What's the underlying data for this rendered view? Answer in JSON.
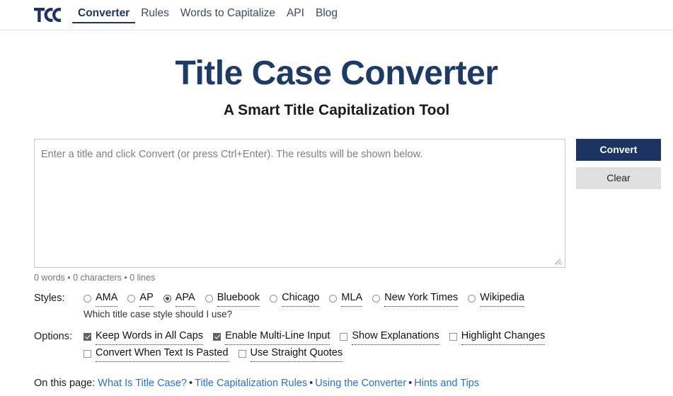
{
  "header": {
    "logo_icon": "tcc-logo-icon",
    "nav": [
      {
        "label": "Converter",
        "active": true
      },
      {
        "label": "Rules",
        "active": false
      },
      {
        "label": "Words to Capitalize",
        "active": false
      },
      {
        "label": "API",
        "active": false
      },
      {
        "label": "Blog",
        "active": false
      }
    ]
  },
  "hero": {
    "title": "Title Case Converter",
    "subtitle": "A Smart Title Capitalization Tool"
  },
  "converter": {
    "textarea_placeholder": "Enter a title and click Convert (or press Ctrl+Enter). The results will be shown below.",
    "textarea_value": "",
    "convert_label": "Convert",
    "clear_label": "Clear",
    "counter": "0 words • 0 characters • 0 lines"
  },
  "styles": {
    "label": "Styles:",
    "options": [
      {
        "label": "AMA",
        "checked": false
      },
      {
        "label": "AP",
        "checked": false
      },
      {
        "label": "APA",
        "checked": true
      },
      {
        "label": "Bluebook",
        "checked": false
      },
      {
        "label": "Chicago",
        "checked": false
      },
      {
        "label": "MLA",
        "checked": false
      },
      {
        "label": "New York Times",
        "checked": false
      },
      {
        "label": "Wikipedia",
        "checked": false
      }
    ],
    "hint": "Which title case style should I use?"
  },
  "options": {
    "label": "Options:",
    "row1": [
      {
        "label": "Keep Words in All Caps",
        "checked": true
      },
      {
        "label": "Enable Multi-Line Input",
        "checked": true
      },
      {
        "label": "Show Explanations",
        "checked": false
      },
      {
        "label": "Highlight Changes",
        "checked": false
      }
    ],
    "row2": [
      {
        "label": "Convert When Text Is Pasted",
        "checked": false
      },
      {
        "label": "Use Straight Quotes",
        "checked": false
      }
    ]
  },
  "onpage": {
    "prefix": "On this page:",
    "links": [
      "What Is Title Case?",
      "Title Capitalization Rules",
      "Using the Converter",
      "Hints and Tips"
    ],
    "separator": "•"
  },
  "colors": {
    "brand_navy": "#1d3461",
    "link_blue": "#2a72c8",
    "button_secondary": "#e0e0e0"
  }
}
